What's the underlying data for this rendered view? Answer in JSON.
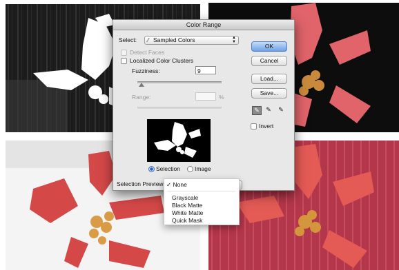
{
  "dialog": {
    "title": "Color Range",
    "select_label": "Select:",
    "select_value": "Sampled Colors",
    "select_icon": "eyedropper-icon",
    "detect_faces": "Detect Faces",
    "localized_clusters": "Localized Color Clusters",
    "fuzziness_label": "Fuzziness:",
    "fuzziness_value": "9",
    "fuzziness_level": 0.05,
    "range_label": "Range:",
    "range_unit": "%",
    "radio_selection": "Selection",
    "radio_image": "Image",
    "selected_radio": "Selection",
    "buttons": {
      "ok": "OK",
      "cancel": "Cancel",
      "load": "Load...",
      "save": "Save..."
    },
    "tools": [
      "eyedropper-icon",
      "eyedropper-plus-icon",
      "eyedropper-minus-icon"
    ],
    "invert_label": "Invert",
    "selection_preview_label": "Selection Preview:",
    "accent": "#6ea2e6"
  },
  "menu": {
    "checked_item": "None",
    "items": [
      "Grayscale",
      "Black Matte",
      "White Matte",
      "Quick Mask"
    ],
    "check_glyph": "✓"
  },
  "panels": {
    "top_left": "grayscale-mask",
    "top_right": "black-matte",
    "bottom_left": "white-matte",
    "bottom_right": "quick-mask"
  }
}
